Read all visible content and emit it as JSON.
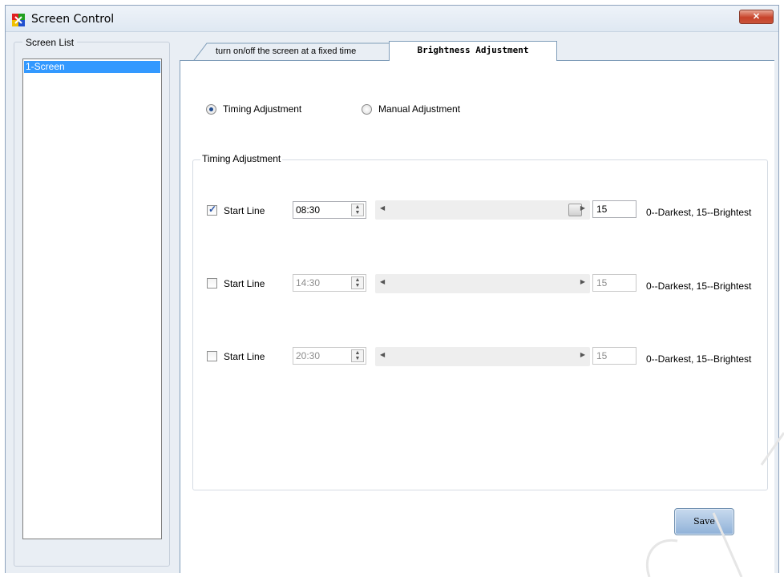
{
  "window": {
    "title": "Screen Control",
    "close_label": "✕"
  },
  "screen_list": {
    "legend": "Screen List",
    "items": [
      "1-Screen"
    ]
  },
  "tabs": [
    {
      "label": "turn on/off the screen at a fixed time",
      "active": false
    },
    {
      "label": "Brightness Adjustment",
      "active": true
    }
  ],
  "mode": {
    "timing_label": "Timing Adjustment",
    "manual_label": "Manual Adjustment",
    "selected": "timing"
  },
  "timing_group": {
    "legend": "Timing Adjustment",
    "rows": [
      {
        "checked": true,
        "label": "Start Line",
        "time": "08:30",
        "level": "15",
        "level_fraction": 1.0,
        "hint": "0--Darkest, 15--Brightest",
        "enabled": true
      },
      {
        "checked": false,
        "label": "Start Line",
        "time": "14:30",
        "level": "15",
        "hint": "0--Darkest, 15--Brightest",
        "enabled": false
      },
      {
        "checked": false,
        "label": "Start Line",
        "time": "20:30",
        "level": "15",
        "hint": "0--Darkest, 15--Brightest",
        "enabled": false
      }
    ]
  },
  "save_label": "Save",
  "colors": {
    "selection": "#3399ff",
    "panel_border": "#7f9db9",
    "window_bg": "#e9eef4"
  }
}
